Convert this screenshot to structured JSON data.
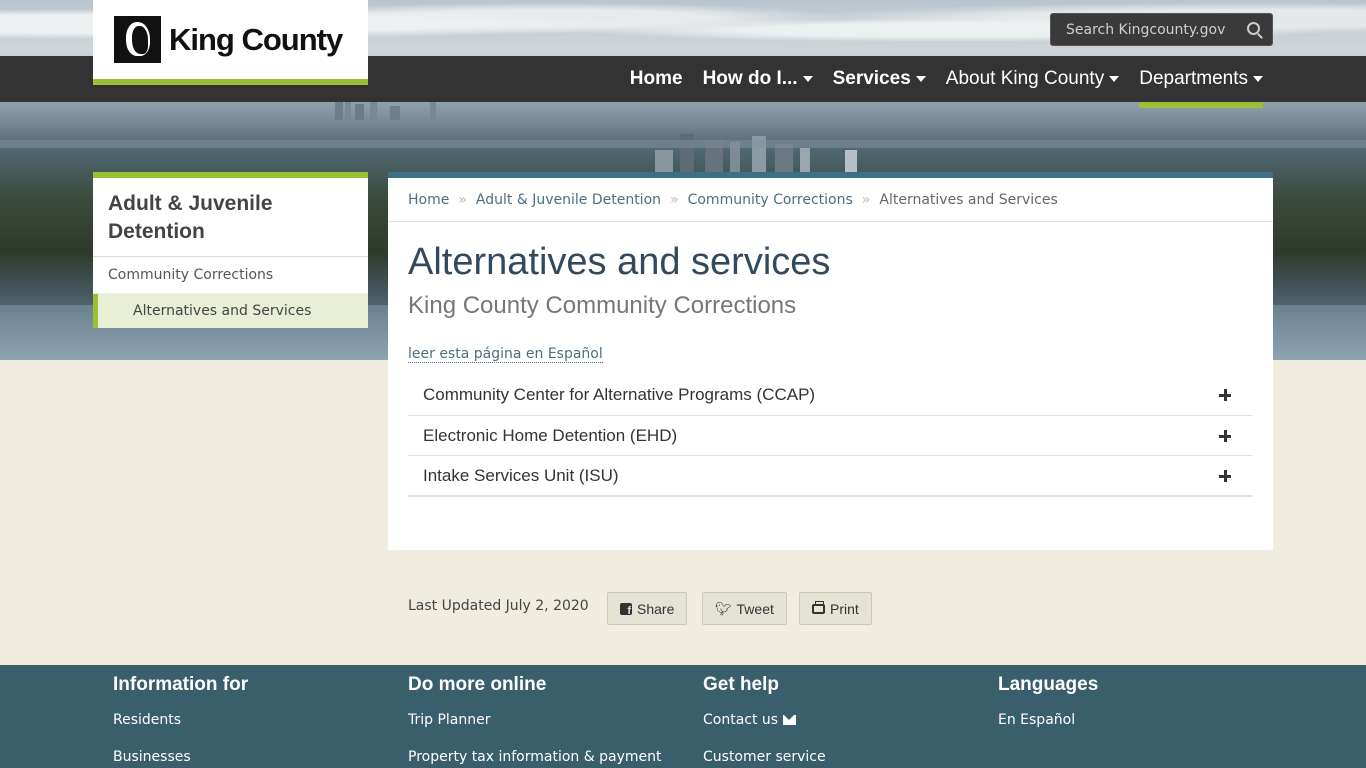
{
  "header": {
    "logo_text": "King County",
    "search_placeholder": "Search Kingcounty.gov"
  },
  "nav": {
    "items": [
      {
        "label": "Home"
      },
      {
        "label": "How do I..."
      },
      {
        "label": "Services"
      },
      {
        "label": "About King County"
      },
      {
        "label": "Departments"
      }
    ]
  },
  "sidebar": {
    "title": "Adult & Juvenile Detention",
    "link": "Community Corrections",
    "sublink": "Alternatives and Services"
  },
  "breadcrumb": {
    "items": [
      "Home",
      "Adult & Juvenile Detention",
      "Community Corrections"
    ],
    "current": "Alternatives and Services"
  },
  "main": {
    "title": "Alternatives and services",
    "subtitle": "King County Community Corrections",
    "spanish_link": "leer esta página en Español",
    "accordion": [
      {
        "label": "Community Center for Alternative Programs (CCAP)"
      },
      {
        "label": "Electronic Home Detention (EHD)"
      },
      {
        "label": "Intake Services Unit (ISU)"
      }
    ]
  },
  "meta": {
    "updated": "Last Updated July 2, 2020",
    "share_label": "Share",
    "tweet_label": "Tweet",
    "print_label": "Print"
  },
  "footer": {
    "columns": [
      {
        "title": "Information for",
        "links": [
          "Residents",
          "Businesses"
        ]
      },
      {
        "title": "Do more online",
        "links": [
          "Trip Planner",
          "Property tax information & payment"
        ]
      },
      {
        "title": "Get help",
        "links": [
          "Contact us",
          "Customer service"
        ]
      },
      {
        "title": "Languages",
        "links": [
          "En Español"
        ]
      }
    ]
  },
  "colors": {
    "accent": "#9ac135",
    "nav_bg": "#333333",
    "footer_bg": "#3a5f6c",
    "main_border": "#3d6f86"
  }
}
